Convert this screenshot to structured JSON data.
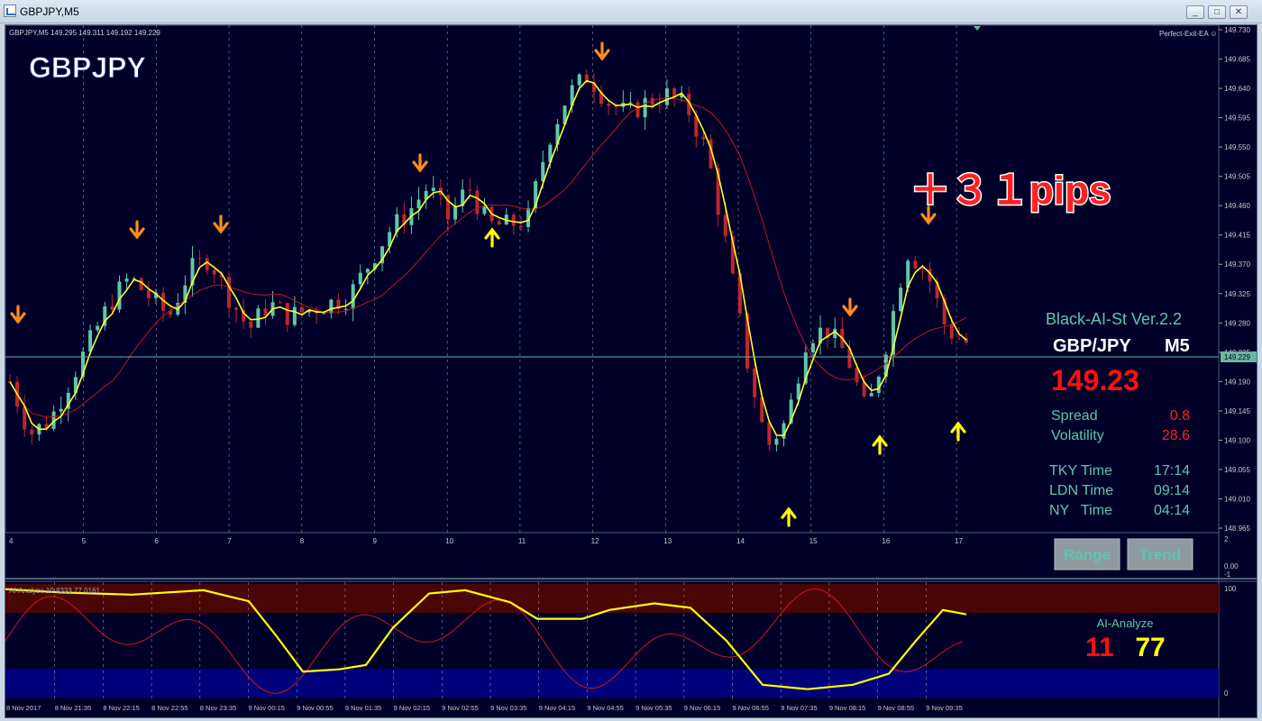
{
  "window": {
    "title": "GBPJPY,M5",
    "buttons": [
      "minimize",
      "maximize",
      "close"
    ]
  },
  "chart_header": {
    "info": "GBPJPY,M5  149.295 149.311 149.192 149.229",
    "symbol_big": "GBPJPY",
    "ea_label": "Perfect-Exit-EA ☺",
    "pips_banner": "＋３１pips"
  },
  "price_scale": [
    "149.730",
    "149.685",
    "149.640",
    "149.595",
    "149.550",
    "149.505",
    "149.460",
    "149.415",
    "149.370",
    "149.325",
    "149.280",
    "149.235",
    "149.190",
    "149.145",
    "149.100",
    "149.055",
    "149.010",
    "148.965"
  ],
  "current_price_label": "149.229",
  "time_axis_upper": [
    "4",
    "5",
    "6",
    "7",
    "8",
    "9",
    "10",
    "11",
    "12",
    "13",
    "14",
    "15",
    "16",
    "17"
  ],
  "sub_scale": [
    "2",
    "0.00",
    "-1"
  ],
  "osc_scale": [
    "100",
    "0"
  ],
  "osc_label": "AI-Analyze 10.8333 77.0161",
  "time_axis_lower": [
    "8 Nov 2017",
    "8 Nov 21:35",
    "8 Nov 22:15",
    "8 Nov 22:55",
    "8 Nov 23:35",
    "9 Nov 00:15",
    "9 Nov 00:55",
    "9 Nov 01:35",
    "9 Nov 02:15",
    "9 Nov 02:55",
    "9 Nov 03:35",
    "9 Nov 04:15",
    "9 Nov 04:55",
    "9 Nov 05:35",
    "9 Nov 06:15",
    "9 Nov 06:55",
    "9 Nov 07:35",
    "9 Nov 08:15",
    "9 Nov 08:55",
    "9 Nov 09:35"
  ],
  "panel": {
    "title": "Black-AI-St Ver.2.2",
    "pair": "GBP/JPY",
    "timeframe": "M5",
    "price": "149.23",
    "spread_label": "Spread",
    "spread_value": "0.8",
    "volatility_label": "Volatility",
    "volatility_value": "28.6",
    "tky_label": "TKY Time",
    "tky_value": "17:14",
    "ldn_label": "LDN Time",
    "ldn_value": "09:14",
    "ny_label": "NY   Time",
    "ny_value": "04:14",
    "range_button": "Range",
    "trend_button": "Trend",
    "ai_label": "AI-Analyze",
    "ai_value1": "11",
    "ai_value2": "77"
  },
  "colors": {
    "background": "#000029",
    "bull": "#5fc7a8",
    "bear": "#c0262b",
    "fast_ma": "#ffff22",
    "slow_ma": "#c01818",
    "sell_arrow": "#ff8c1a",
    "buy_arrow": "#ffff00"
  },
  "chart_data": {
    "type": "line",
    "symbol": "GBPJPY",
    "timeframe": "M5",
    "ylim": [
      148.965,
      149.73
    ],
    "last_price": 149.229,
    "series": [
      {
        "name": "price",
        "values": [
          149.19,
          149.11,
          149.13,
          149.19,
          149.25,
          149.31,
          149.35,
          149.32,
          149.29,
          149.36,
          149.38,
          149.32,
          149.27,
          149.31,
          149.29,
          149.3,
          149.31,
          149.32,
          149.37,
          149.42,
          149.45,
          149.49,
          149.44,
          149.49,
          149.43,
          149.43,
          149.44,
          149.56,
          149.63,
          149.66,
          149.62,
          149.6,
          149.62,
          149.63,
          149.61,
          149.54,
          149.39,
          149.22,
          149.09,
          149.13,
          149.26,
          149.27,
          149.23,
          149.14,
          149.25,
          149.39,
          149.36,
          149.27,
          149.25
        ]
      }
    ]
  }
}
